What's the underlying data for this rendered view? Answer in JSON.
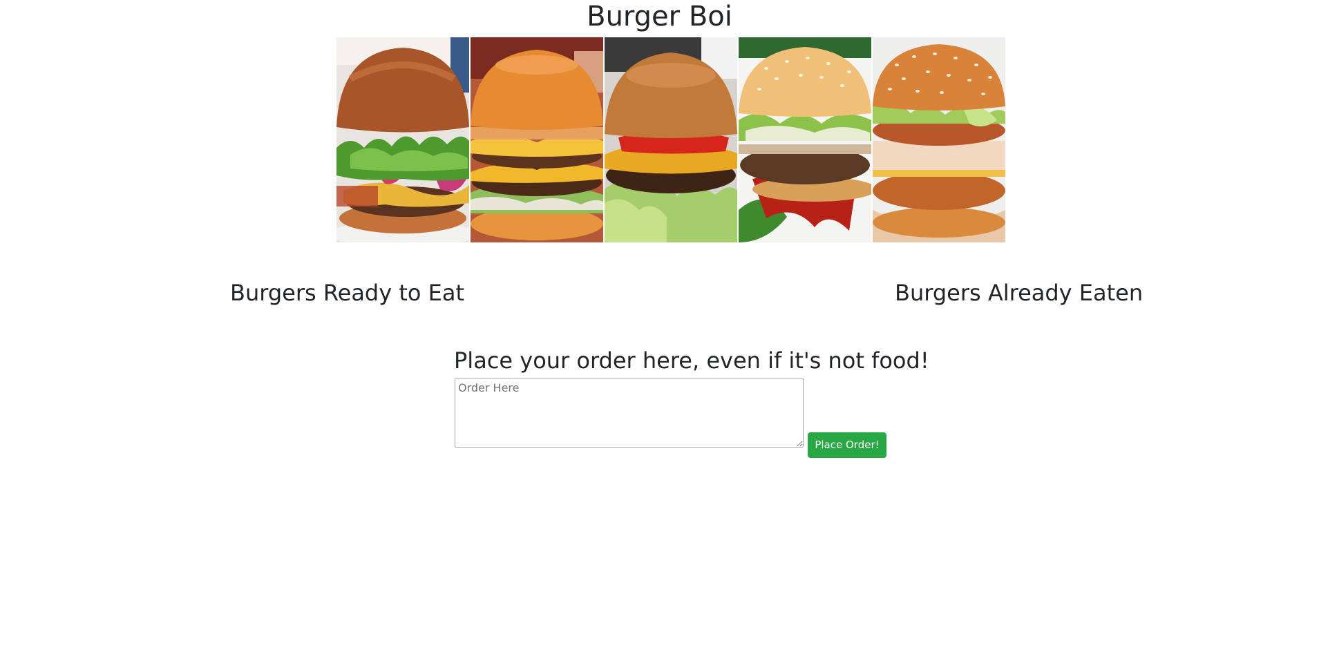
{
  "site": {
    "title": "Burger Boi"
  },
  "banner": {
    "images": [
      {
        "name": "burger-photo-1",
        "description": "brioche bun burger with lettuce and red onion"
      },
      {
        "name": "burger-photo-2",
        "description": "double cheeseburger with onion"
      },
      {
        "name": "burger-photo-3",
        "description": "cheeseburger with tomato and lettuce"
      },
      {
        "name": "burger-photo-4",
        "description": "sesame burger with lettuce and ketchup"
      },
      {
        "name": "burger-photo-5",
        "description": "crispy chicken sandwich with sesame bun"
      }
    ]
  },
  "columns": {
    "ready_heading": "Burgers Ready to Eat",
    "eaten_heading": "Burgers Already Eaten"
  },
  "order": {
    "heading": "Place your order here, even if it's not food!",
    "input_value": "",
    "input_placeholder": "Order Here",
    "button_label": "Place Order!"
  },
  "colors": {
    "text": "#212529",
    "button_success": "#28a745",
    "button_text": "#ffffff",
    "background": "#ffffff"
  }
}
